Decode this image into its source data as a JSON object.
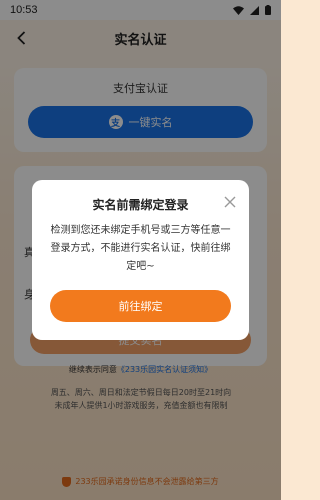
{
  "status_bar": {
    "time": "10:53"
  },
  "header": {
    "title": "实名认证"
  },
  "alipay": {
    "title": "支付宝认证",
    "button_label": "一键实名",
    "logo_glyph": "支"
  },
  "form": {
    "name_label_partial": "真",
    "id_label_partial": "身",
    "submit_label": "提交实名"
  },
  "agreement": {
    "prefix": "继续表示同意",
    "link_text": "《233乐园实名认证须知》"
  },
  "notice": {
    "text": "周五、周六、周日和法定节假日每日20时至21时向未成年人提供1小时游戏服务，充值金额也有限制"
  },
  "bottom_tip": {
    "text": "233乐园承诺身份信息不会泄露给第三方"
  },
  "dialog": {
    "title": "实名前需绑定登录",
    "message": "检测到您还未绑定手机号或三方等任意一登录方式，不能进行实名认证，快前往绑定吧~",
    "button_label": "前往绑定"
  },
  "colors": {
    "accent_orange": "#f27a1d",
    "alipay_blue": "#1a73e8",
    "link_blue": "#1a73e8"
  }
}
